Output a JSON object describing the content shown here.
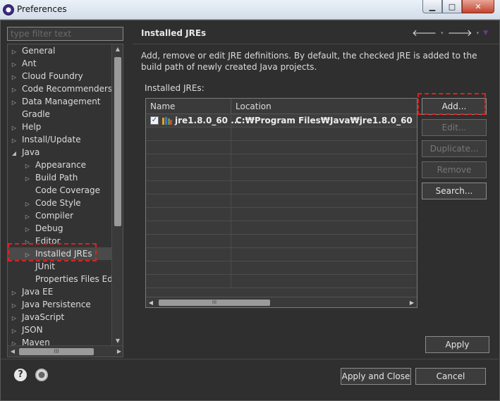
{
  "window": {
    "title": "Preferences",
    "controls": {
      "minimize": "▁",
      "maximize": "□",
      "close": "✕"
    }
  },
  "sidebar": {
    "filter_placeholder": "type filter text",
    "items": [
      {
        "label": "General",
        "expandable": true,
        "indent": 0
      },
      {
        "label": "Ant",
        "expandable": true,
        "indent": 0
      },
      {
        "label": "Cloud Foundry",
        "expandable": true,
        "indent": 0
      },
      {
        "label": "Code Recommenders",
        "expandable": true,
        "indent": 0
      },
      {
        "label": "Data Management",
        "expandable": true,
        "indent": 0
      },
      {
        "label": "Gradle",
        "expandable": false,
        "indent": 0
      },
      {
        "label": "Help",
        "expandable": true,
        "indent": 0
      },
      {
        "label": "Install/Update",
        "expandable": true,
        "indent": 0
      },
      {
        "label": "Java",
        "expandable": true,
        "expanded": true,
        "indent": 0
      },
      {
        "label": "Appearance",
        "expandable": true,
        "indent": 1
      },
      {
        "label": "Build Path",
        "expandable": true,
        "indent": 1
      },
      {
        "label": "Code Coverage",
        "expandable": false,
        "indent": 1
      },
      {
        "label": "Code Style",
        "expandable": true,
        "indent": 1
      },
      {
        "label": "Compiler",
        "expandable": true,
        "indent": 1
      },
      {
        "label": "Debug",
        "expandable": true,
        "indent": 1
      },
      {
        "label": "Editor",
        "expandable": true,
        "indent": 1
      },
      {
        "label": "Installed JREs",
        "expandable": true,
        "indent": 1,
        "selected": true
      },
      {
        "label": "JUnit",
        "expandable": false,
        "indent": 1
      },
      {
        "label": "Properties Files Editor",
        "expandable": false,
        "indent": 1
      },
      {
        "label": "Java EE",
        "expandable": true,
        "indent": 0
      },
      {
        "label": "Java Persistence",
        "expandable": true,
        "indent": 0
      },
      {
        "label": "JavaScript",
        "expandable": true,
        "indent": 0
      },
      {
        "label": "JSON",
        "expandable": true,
        "indent": 0
      },
      {
        "label": "Maven",
        "expandable": true,
        "indent": 0
      }
    ],
    "hscroll_grip": "III"
  },
  "page": {
    "title": "Installed JREs",
    "description": "Add, remove or edit JRE definitions. By default, the checked JRE is added to the build path of newly created Java projects.",
    "group_label": "Installed JREs:",
    "nav": {
      "back": "🡐",
      "forward": "🡒",
      "dropdown": "▾",
      "menu": "▼"
    }
  },
  "jre_table": {
    "columns": [
      "Name",
      "Location"
    ],
    "rows": [
      {
        "checked": true,
        "name": "jre1.8.0_60 ...",
        "location": "C:₩Program Files₩Java₩jre1.8.0_60"
      }
    ],
    "empty_rows": 12,
    "hscroll_grip": "III"
  },
  "buttons": {
    "add": "Add...",
    "edit": "Edit...",
    "duplicate": "Duplicate...",
    "remove": "Remove",
    "search": "Search...",
    "apply": "Apply",
    "apply_and_close": "Apply and Close",
    "cancel": "Cancel"
  },
  "footer": {
    "help": "?"
  },
  "colors": {
    "highlight": "#e02020",
    "background": "#2f2f2f"
  }
}
